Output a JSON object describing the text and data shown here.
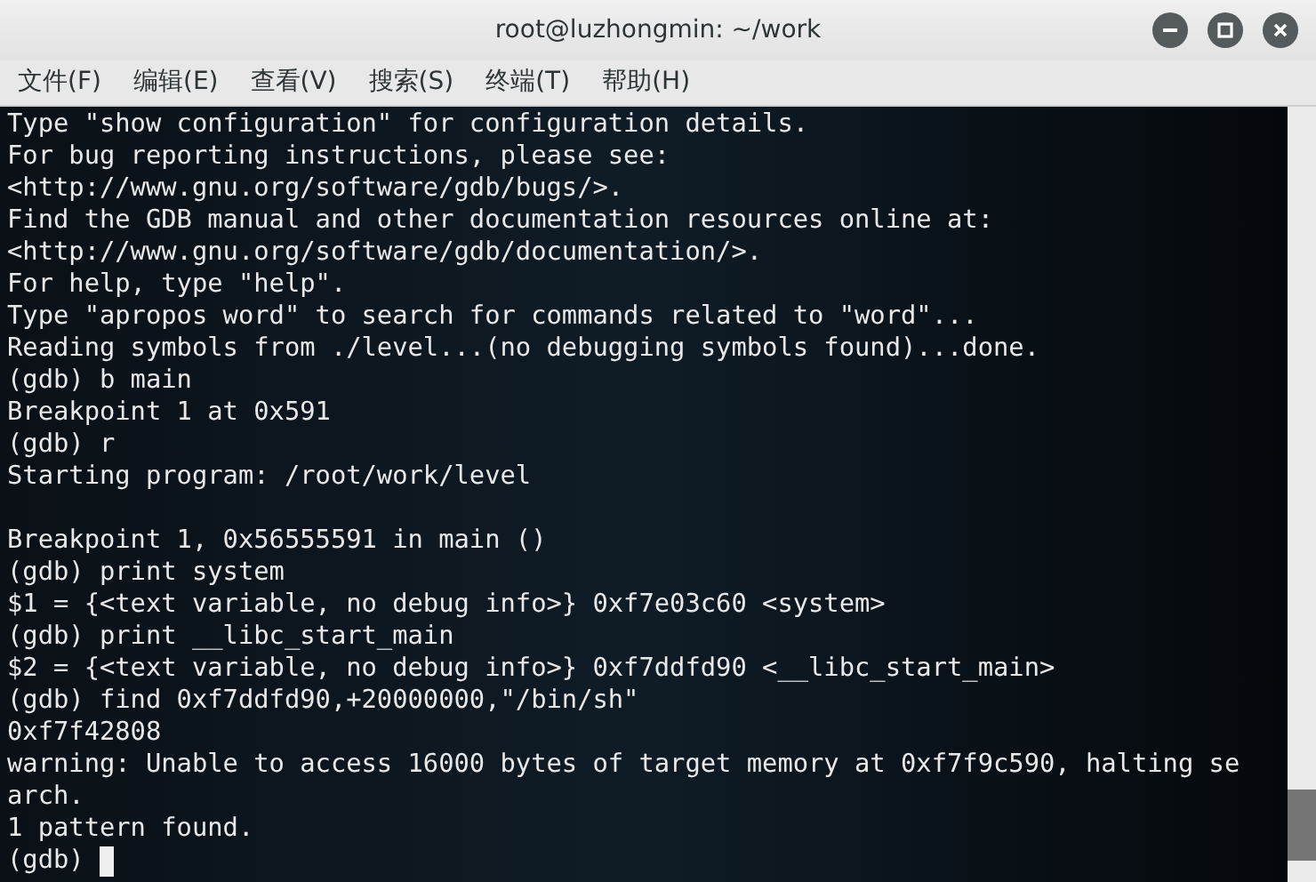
{
  "window": {
    "title": "root@luzhongmin: ~/work"
  },
  "menu": [
    "文件(F)",
    "编辑(E)",
    "查看(V)",
    "搜索(S)",
    "终端(T)",
    "帮助(H)"
  ],
  "terminal": {
    "lines": [
      {
        "text": "Type \"show configuration\" for configuration details."
      },
      {
        "text": "For bug reporting instructions, please see:"
      },
      {
        "text": "<http://www.gnu.org/software/gdb/bugs/>."
      },
      {
        "text": "Find the GDB manual and other documentation resources online at:"
      },
      {
        "text": "<http://www.gnu.org/software/gdb/documentation/>."
      },
      {
        "text": "For help, type \"help\"."
      },
      {
        "text": "Type \"apropos word\" to search for commands related to \"word\"..."
      },
      {
        "text": "Reading symbols from ./level...(no debugging symbols found)...done."
      },
      {
        "text": "(gdb) b main"
      },
      {
        "text": "Breakpoint 1 at 0x591"
      },
      {
        "text": "(gdb) r"
      },
      {
        "text": "Starting program: /root/work/level"
      },
      {
        "text": "Breakpoint 1, 0x56555591 in main ()",
        "gap_before": true
      },
      {
        "text": "(gdb) print system"
      },
      {
        "text": "$1 = {<text variable, no debug info>} 0xf7e03c60 <system>"
      },
      {
        "text": "(gdb) print __libc_start_main"
      },
      {
        "text": "$2 = {<text variable, no debug info>} 0xf7ddfd90 <__libc_start_main>"
      },
      {
        "text": "(gdb) find 0xf7ddfd90,+20000000,\"/bin/sh\""
      },
      {
        "text": "0xf7f42808"
      },
      {
        "text": "warning: Unable to access 16000 bytes of target memory at 0xf7f9c590, halting se"
      },
      {
        "text": "arch."
      },
      {
        "text": "1 pattern found."
      }
    ],
    "prompt": "(gdb)"
  }
}
